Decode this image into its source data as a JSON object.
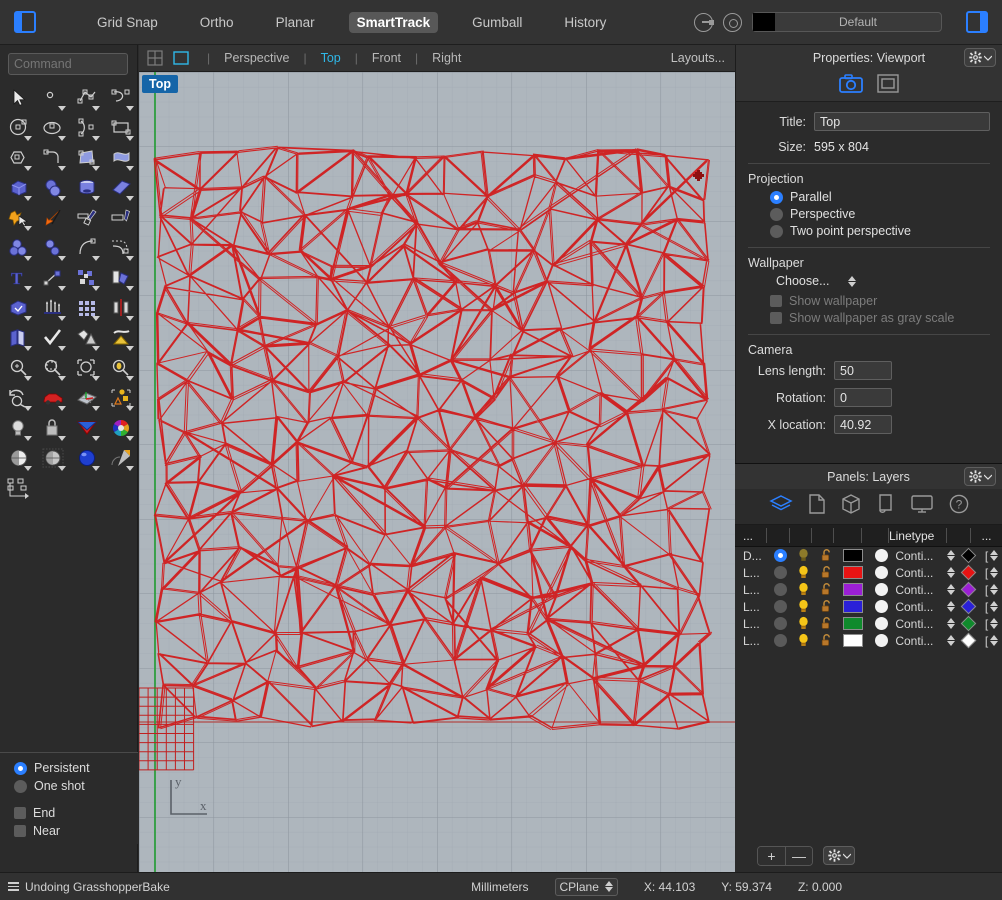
{
  "topbar": {
    "left_panel_toggle": "left-panel-toggle",
    "right_panel_toggle": "right-panel-toggle",
    "items": [
      {
        "label": "Grid Snap",
        "active": false
      },
      {
        "label": "Ortho",
        "active": false
      },
      {
        "label": "Planar",
        "active": false
      },
      {
        "label": "SmartTrack",
        "active": true
      },
      {
        "label": "Gumball",
        "active": false
      },
      {
        "label": "History",
        "active": false
      }
    ],
    "layer_swatch_color": "#000000",
    "layer_name": "Default"
  },
  "command": {
    "placeholder": "Command",
    "value": ""
  },
  "tools": {
    "rows": [
      [
        "select-arrow-icon",
        "point-icon",
        "polyline-icon",
        "curve-icon"
      ],
      [
        "circle-icon",
        "ellipse-icon",
        "arc-icon",
        "rectangle-icon"
      ],
      [
        "polygon-icon",
        "fillet-curve-icon",
        "surface-edge-icon",
        "surface-sweep-icon"
      ],
      [
        "box-solid-icon",
        "sphere-boolean-icon",
        "cylinder-icon",
        "surface-patch-icon"
      ],
      [
        "explode-icon",
        "arrow-orange-icon",
        "trim-icon",
        "split-icon"
      ],
      [
        "boolean-union-icon",
        "boolean-difference-icon",
        "blend-curve-icon",
        "offset-curve-icon"
      ],
      [
        "text-icon",
        "dimension-icon",
        "array-icon",
        "transform-icon"
      ],
      [
        "extrude-icon",
        "loft-icon",
        "grid-array-icon",
        "mirror-icon"
      ],
      [
        "unroll-icon",
        "check-icon",
        "mesh-icon",
        "mesh-from-surface-icon"
      ],
      [
        "zoom-icon",
        "zoom-window-icon",
        "zoom-extents-icon",
        "zoom-selected-icon"
      ],
      [
        "rotate-view-icon",
        "car-icon",
        "cplane-icon",
        "select-objects-icon"
      ],
      [
        "light-icon",
        "lock-icon",
        "material-icon",
        "color-wheel-icon"
      ],
      [
        "shaded-view-icon",
        "ghosted-view-icon",
        "rendered-view-icon",
        "render-icon"
      ],
      [
        "block-icon",
        "",
        "",
        ""
      ]
    ]
  },
  "osnap": {
    "persistent_label": "Persistent",
    "persistent_on": true,
    "oneshot_label": "One shot",
    "oneshot_on": false,
    "checks": [
      {
        "label": "End",
        "checked": false
      },
      {
        "label": "Near",
        "checked": false
      }
    ]
  },
  "viewport": {
    "tabbar": {
      "four_view_icon": "four-viewport-icon",
      "single_view_icon": "single-viewport-icon",
      "tabs": [
        {
          "label": "Perspective",
          "active": false
        },
        {
          "label": "Top",
          "active": true
        },
        {
          "label": "Front",
          "active": false
        },
        {
          "label": "Right",
          "active": false
        }
      ],
      "layouts_label": "Layouts..."
    },
    "label": "Top",
    "axis_x": "x",
    "axis_y": "y",
    "bg_color": "#aeb6bd",
    "grid_line_color": "#9aa2ab",
    "grid_major_color": "#8b939c",
    "x_axis_color": "#b05b5b",
    "y_axis_color": "#43a047",
    "geometry_color": "#d11c1c"
  },
  "properties": {
    "header_title": "Properties: Viewport",
    "gear_label": "gear-menu",
    "icons": [
      "camera-icon",
      "viewport-frame-icon"
    ],
    "title_label": "Title:",
    "title_value": "Top",
    "size_label": "Size:",
    "size_value": "595 x 804",
    "projection_title": "Projection",
    "projection_options": [
      {
        "label": "Parallel",
        "selected": true
      },
      {
        "label": "Perspective",
        "selected": false
      },
      {
        "label": "Two point perspective",
        "selected": false
      }
    ],
    "wallpaper_title": "Wallpaper",
    "wallpaper_choose": "Choose...",
    "wallpaper_checks": [
      {
        "label": "Show wallpaper",
        "checked": false
      },
      {
        "label": "Show wallpaper as gray scale",
        "checked": false
      }
    ],
    "camera_title": "Camera",
    "camera_fields": [
      {
        "label": "Lens length:",
        "value": "50"
      },
      {
        "label": "Rotation:",
        "value": "0"
      },
      {
        "label": "X location:",
        "value": "40.92"
      }
    ]
  },
  "layers": {
    "header_title": "Panels: Layers",
    "gear_label": "gear-menu",
    "icons": [
      "layers-icon",
      "properties-page-icon",
      "object-box-icon",
      "named-views-icon",
      "display-icon",
      "help-icon"
    ],
    "columns": [
      "...",
      "",
      "",
      "",
      "",
      "",
      "Linetype",
      "",
      "..."
    ],
    "linetype_header": "Linetype",
    "ellipsis_header": "...",
    "rows": [
      {
        "name": "D...",
        "current": true,
        "color": "#000000",
        "linetype": "Conti...",
        "print_color": "#000000"
      },
      {
        "name": "L...",
        "current": false,
        "color": "#e81313",
        "linetype": "Conti...",
        "print_color": "#e81313"
      },
      {
        "name": "L...",
        "current": false,
        "color": "#9b1fd4",
        "linetype": "Conti...",
        "print_color": "#9b1fd4"
      },
      {
        "name": "L...",
        "current": false,
        "color": "#2a20d8",
        "linetype": "Conti...",
        "print_color": "#2a20d8"
      },
      {
        "name": "L...",
        "current": false,
        "color": "#0f8a2c",
        "linetype": "Conti...",
        "print_color": "#0f8a2c"
      },
      {
        "name": "L...",
        "current": false,
        "color": "#ffffff",
        "linetype": "Conti...",
        "print_color": "#ffffff"
      }
    ],
    "add_label": "+",
    "remove_label": "—"
  },
  "statusbar": {
    "message": "Undoing GrasshopperBake",
    "units": "Millimeters",
    "cplane": "CPlane",
    "x": "X: 44.103",
    "y": "Y: 59.374",
    "z": "Z: 0.000"
  }
}
